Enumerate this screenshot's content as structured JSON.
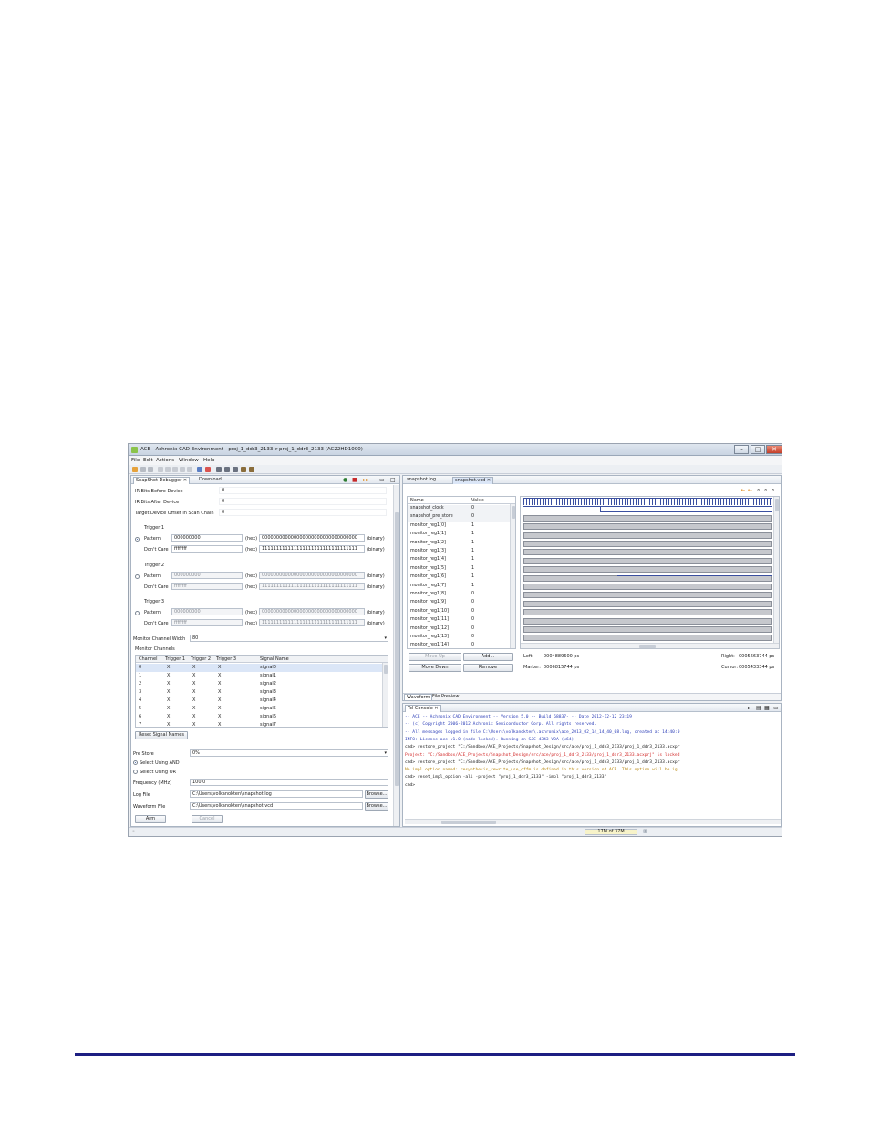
{
  "window": {
    "title": "ACE - Achronix CAD Environment - proj_1_ddr3_2133->proj_1_ddr3_2133 (AC22HD1000)"
  },
  "menu": [
    "File",
    "Edit",
    "Actions",
    "Window",
    "Help"
  ],
  "left_panel": {
    "tabs": [
      "SnapShot Debugger",
      "Download"
    ],
    "ir_before_label": "IR Bits Before Device",
    "ir_before_value": "0",
    "ir_after_label": "IR Bits After Device",
    "ir_after_value": "0",
    "offset_label": "Target Device Offset in Scan Chain",
    "offset_value": "0",
    "triggers": [
      {
        "title": "Trigger 1",
        "pattern_label": "Pattern",
        "pattern_hex": "000000000",
        "pattern_bin": "000000000000000000000000000000000",
        "dontcare_label": "Don't Care",
        "dontcare_hex": "ffffffff",
        "dontcare_bin": "111111111111111111111111111111111"
      },
      {
        "title": "Trigger 2",
        "pattern_label": "Pattern",
        "pattern_hex": "000000000",
        "pattern_bin": "000000000000000000000000000000000",
        "dontcare_label": "Don't Care",
        "dontcare_hex": "ffffffff",
        "dontcare_bin": "111111111111111111111111111111111"
      },
      {
        "title": "Trigger 3",
        "pattern_label": "Pattern",
        "pattern_hex": "000000000",
        "pattern_bin": "000000000000000000000000000000000",
        "dontcare_label": "Don't Care",
        "dontcare_hex": "ffffffff",
        "dontcare_bin": "111111111111111111111111111111111"
      }
    ],
    "hex_tag": "(hex)",
    "binary_tag": "(binary)",
    "monitor_width_label": "Monitor Channel Width",
    "monitor_width_value": "80",
    "monitor_channels_label": "Monitor Channels",
    "channel_headers": [
      "Channel",
      "Trigger 1",
      "Trigger 2",
      "Trigger 3",
      "Signal Name"
    ],
    "channel_rows": [
      [
        "0",
        "X",
        "X",
        "X",
        "signal0"
      ],
      [
        "1",
        "X",
        "X",
        "X",
        "signal1"
      ],
      [
        "2",
        "X",
        "X",
        "X",
        "signal2"
      ],
      [
        "3",
        "X",
        "X",
        "X",
        "signal3"
      ],
      [
        "4",
        "X",
        "X",
        "X",
        "signal4"
      ],
      [
        "5",
        "X",
        "X",
        "X",
        "signal5"
      ],
      [
        "6",
        "X",
        "X",
        "X",
        "signal6"
      ],
      [
        "7",
        "X",
        "X",
        "X",
        "signal7"
      ]
    ],
    "reset_names_button": "Reset Signal Names",
    "prestore_label": "Pre Store",
    "prestore_value": "0%",
    "select_and_label": "Select Using AND",
    "select_or_label": "Select Using OR",
    "frequency_label": "Frequency (MHz)",
    "frequency_value": "100.0",
    "logfile_label": "Log File",
    "logfile_value": "C:\\Users\\volkanokten\\snapshot.log",
    "waveform_label": "Waveform File",
    "waveform_value": "C:\\Users\\volkanokten\\snapshot.vcd",
    "browse_label": "Browse...",
    "arm_button": "Arm",
    "cancel_button": "Cancel"
  },
  "right_panel": {
    "tabs": [
      "snapshot.log",
      "snapshot.vcd"
    ],
    "signal_headers": [
      "Name",
      "Value"
    ],
    "signals": [
      {
        "name": "snapshot_clock",
        "value": "0",
        "kind": "clock"
      },
      {
        "name": "snapshot_pre_store",
        "value": "0",
        "kind": "step"
      },
      {
        "name": "monitor_reg1[0]",
        "value": "1",
        "kind": "bus"
      },
      {
        "name": "monitor_reg1[1]",
        "value": "1",
        "kind": "bus"
      },
      {
        "name": "monitor_reg1[2]",
        "value": "1",
        "kind": "bus"
      },
      {
        "name": "monitor_reg1[3]",
        "value": "1",
        "kind": "bus"
      },
      {
        "name": "monitor_reg1[4]",
        "value": "1",
        "kind": "bus"
      },
      {
        "name": "monitor_reg1[5]",
        "value": "1",
        "kind": "bus"
      },
      {
        "name": "monitor_reg1[6]",
        "value": "1",
        "kind": "bus"
      },
      {
        "name": "monitor_reg1[7]",
        "value": "1",
        "kind": "step2"
      },
      {
        "name": "monitor_reg1[8]",
        "value": "0",
        "kind": "bus"
      },
      {
        "name": "monitor_reg1[9]",
        "value": "0",
        "kind": "bus"
      },
      {
        "name": "monitor_reg1[10]",
        "value": "0",
        "kind": "bus"
      },
      {
        "name": "monitor_reg1[11]",
        "value": "0",
        "kind": "bus"
      },
      {
        "name": "monitor_reg1[12]",
        "value": "0",
        "kind": "bus"
      },
      {
        "name": "monitor_reg1[13]",
        "value": "0",
        "kind": "bus"
      },
      {
        "name": "monitor_reg1[14]",
        "value": "0",
        "kind": "bus"
      }
    ],
    "move_up": "Move Up",
    "add": "Add...",
    "move_down": "Move Down",
    "remove": "Remove",
    "left_label": "Left:",
    "left_value": "0004889600 ps",
    "right_label": "Right:",
    "right_value": "0005663744 ps",
    "marker_label": "Marker:",
    "marker_value": "0006815744 ps",
    "cursor_label": "Cursor:",
    "cursor_value": "0005433344 ps",
    "bottom_tabs": [
      "Waveform",
      "File Preview"
    ]
  },
  "console": {
    "tab": "Tcl Console",
    "lines": [
      {
        "text": "-- ACE -- Achronix CAD Environment -- Version 5.0 -- Build  68837- -- Date 2012-12-12 23:19",
        "color": "#2d3fb8"
      },
      {
        "text": "-- (c) Copyright 2006-2012 Achronix Semiconductor Corp.  All rights reserved.",
        "color": "#2d3fb8"
      },
      {
        "text": "-- All messages logged in file C:\\Users\\volkanokten\\.achronix\\ace_2013_02_14_14_40_08.log, created at 14:40:0",
        "color": "#2d3fb8"
      },
      {
        "text": "INFO: License ace v1.0 (node-locked). Running on SJC-4343 VOA (x64).",
        "color": "#2d3fb8"
      },
      {
        "text": "cmd> restore_project \"C:/Sandbox/ACE_Projects/Snapshot_Design/src/ace/proj_1_ddr3_2133/proj_1_ddr3_2133.acxpr",
        "color": "#1b1b1b"
      },
      {
        "text": "Project: \"C:/Sandbox/ACE_Projects/Snapshot_Design/src/ace/proj_1_ddr3_2133/proj_1_ddr3_2133.acxprj\" is locked",
        "color": "#d22a2a"
      },
      {
        "text": "cmd> restore_project \"C:/Sandbox/ACE_Projects/Snapshot_Design/src/ace/proj_1_ddr3_2133/proj_1_ddr3_2133.acxpr",
        "color": "#1b1b1b"
      },
      {
        "text": "No impl option named: resynthesis_rewrite_use_dffm is defined in this version of ACE.  This option will be ig",
        "color": "#b8860b"
      },
      {
        "text": "cmd> reset_impl_option -all -project \"proj_1_ddr3_2133\" -impl \"proj_1_ddr3_2133\"",
        "color": "#1b1b1b"
      },
      {
        "text": "cmd>",
        "color": "#1b1b1b"
      }
    ]
  },
  "statusbar": {
    "memory": "17M of 37M"
  }
}
